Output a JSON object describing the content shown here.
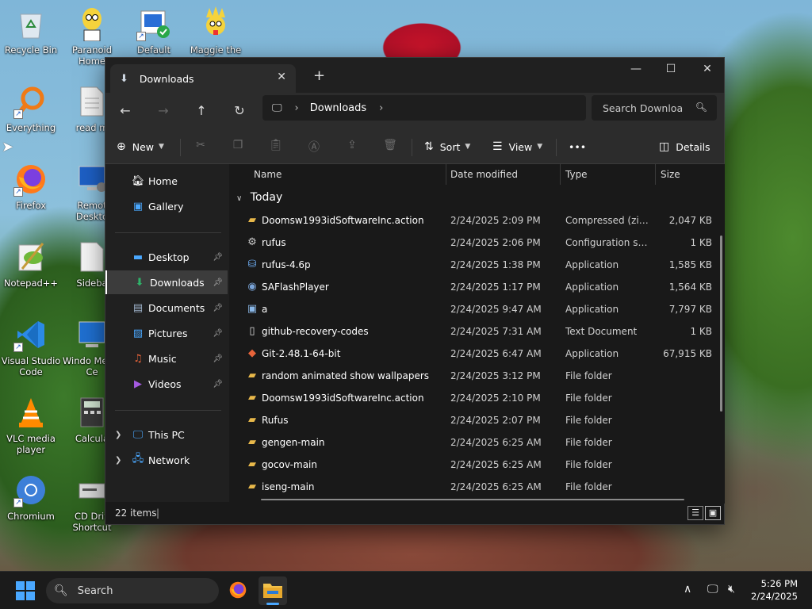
{
  "desktop": {
    "icons": [
      {
        "label": "Recycle Bin",
        "icon": "recycle-bin-icon"
      },
      {
        "label": "Paranoid Home",
        "icon": "homer-icon"
      },
      {
        "label": "Default",
        "icon": "default-shortcut-icon"
      },
      {
        "label": "Maggie the",
        "icon": "maggie-icon"
      },
      {
        "label": "Everything",
        "icon": "everything-search-icon"
      },
      {
        "label": "read m",
        "icon": "document-icon"
      },
      {
        "label": "Firefox",
        "icon": "firefox-icon"
      },
      {
        "label": "Remot Deskto",
        "icon": "remote-desktop-icon"
      },
      {
        "label": "Notepad++",
        "icon": "notepadpp-icon"
      },
      {
        "label": "Sideba",
        "icon": "sidebar-icon"
      },
      {
        "label": "Visual Studio Code",
        "icon": "vscode-icon"
      },
      {
        "label": "Windo Media Ce",
        "icon": "windows-media-center-icon"
      },
      {
        "label": "VLC media player",
        "icon": "vlc-icon"
      },
      {
        "label": "Calcula",
        "icon": "calculator-icon"
      },
      {
        "label": "Chromium",
        "icon": "chromium-icon"
      },
      {
        "label": "CD Driv Shortcut",
        "icon": "cd-drive-icon"
      }
    ]
  },
  "explorer": {
    "tab_title": "Downloads",
    "breadcrumb": {
      "location": "Downloads"
    },
    "search_placeholder": "Search Downloa",
    "commands": {
      "new_label": "New",
      "sort_label": "Sort",
      "view_label": "View",
      "more_label": "•••",
      "details_label": "Details"
    },
    "nav": {
      "home": "Home",
      "gallery": "Gallery",
      "desktop": "Desktop",
      "downloads": "Downloads",
      "documents": "Documents",
      "pictures": "Pictures",
      "music": "Music",
      "videos": "Videos",
      "this_pc": "This PC",
      "network": "Network"
    },
    "columns": {
      "name": "Name",
      "date": "Date modified",
      "type": "Type",
      "size": "Size"
    },
    "group_label": "Today",
    "files": [
      {
        "name": "Doomsw1993idSoftwareInc.action",
        "date": "2/24/2025 2:09 PM",
        "type": "Compressed (zipp...",
        "size": "2,047 KB",
        "icon": "zip-folder-icon"
      },
      {
        "name": "rufus",
        "date": "2/24/2025 2:06 PM",
        "type": "Configuration sett...",
        "size": "1 KB",
        "icon": "config-file-icon"
      },
      {
        "name": "rufus-4.6p",
        "date": "2/24/2025 1:38 PM",
        "type": "Application",
        "size": "1,585 KB",
        "icon": "rufus-app-icon"
      },
      {
        "name": "SAFlashPlayer",
        "date": "2/24/2025 1:17 PM",
        "type": "Application",
        "size": "1,564 KB",
        "icon": "flash-player-icon"
      },
      {
        "name": "a",
        "date": "2/24/2025 9:47 AM",
        "type": "Application",
        "size": "7,797 KB",
        "icon": "app-window-icon"
      },
      {
        "name": "github-recovery-codes",
        "date": "2/24/2025 7:31 AM",
        "type": "Text Document",
        "size": "1 KB",
        "icon": "text-file-icon"
      },
      {
        "name": "Git-2.48.1-64-bit",
        "date": "2/24/2025 6:47 AM",
        "type": "Application",
        "size": "67,915 KB",
        "icon": "git-installer-icon"
      },
      {
        "name": "random animated show wallpapers",
        "date": "2/24/2025 3:12 PM",
        "type": "File folder",
        "size": "",
        "icon": "folder-icon"
      },
      {
        "name": "Doomsw1993idSoftwareInc.action",
        "date": "2/24/2025 2:10 PM",
        "type": "File folder",
        "size": "",
        "icon": "folder-icon"
      },
      {
        "name": "Rufus",
        "date": "2/24/2025 2:07 PM",
        "type": "File folder",
        "size": "",
        "icon": "folder-icon"
      },
      {
        "name": "gengen-main",
        "date": "2/24/2025 6:25 AM",
        "type": "File folder",
        "size": "",
        "icon": "folder-icon"
      },
      {
        "name": "gocov-main",
        "date": "2/24/2025 6:25 AM",
        "type": "File folder",
        "size": "",
        "icon": "folder-icon"
      },
      {
        "name": "iseng-main",
        "date": "2/24/2025 6:25 AM",
        "type": "File folder",
        "size": "",
        "icon": "folder-icon"
      }
    ],
    "status": {
      "item_count": "22 items"
    }
  },
  "taskbar": {
    "search_label": "Search",
    "time": "5:26 PM",
    "date": "2/24/2025"
  },
  "colors": {
    "accent": "#4aa8ff",
    "window_bg": "#191919",
    "folder": "#e8b84a"
  }
}
